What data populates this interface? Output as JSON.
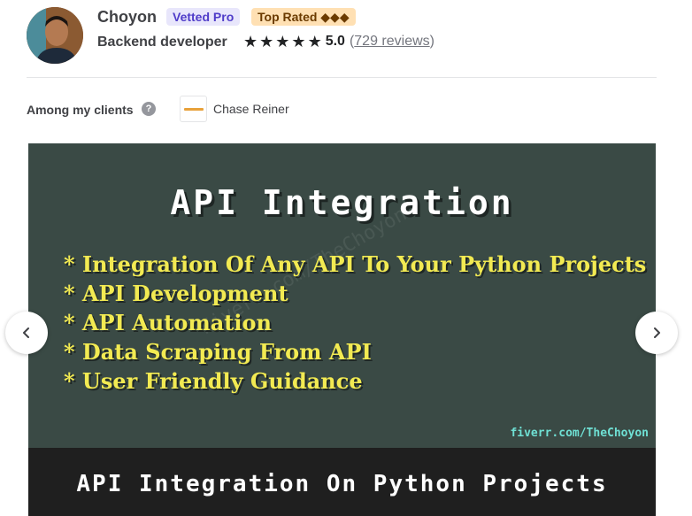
{
  "seller": {
    "name": "Choyon",
    "badges": {
      "vetted": "Vetted Pro",
      "top_rated": "Top Rated ◆◆◆"
    },
    "tagline": "Backend developer",
    "rating": {
      "stars": 5,
      "score": "5.0",
      "reviews_open": "(",
      "reviews_link": "729 reviews",
      "reviews_close": ")"
    }
  },
  "clients": {
    "label": "Among my clients",
    "help_icon": "?",
    "items": [
      {
        "name": "Chase Reiner"
      }
    ]
  },
  "gallery": {
    "slide": {
      "title": "API Integration",
      "features": [
        "Integration Of Any API To Your Python Projects",
        "API Development",
        "API Automation",
        "Data Scraping From API",
        "User Friendly Guidance"
      ],
      "watermark": "Fiverr.com/TheChoyon",
      "link": "fiverr.com/TheChoyon",
      "bottom_text": "API Integration On Python Projects"
    },
    "prev_icon": "chevron-left-icon",
    "next_icon": "chevron-right-icon"
  },
  "colors": {
    "vetted_badge_bg": "#e8e6fb",
    "vetted_badge_text": "#4f3cc9",
    "top_rated_bg": "#ffe0b3",
    "slide_bg": "#3a4a45",
    "feature_text": "#f2ea52",
    "link_text": "#6fe0d4"
  }
}
